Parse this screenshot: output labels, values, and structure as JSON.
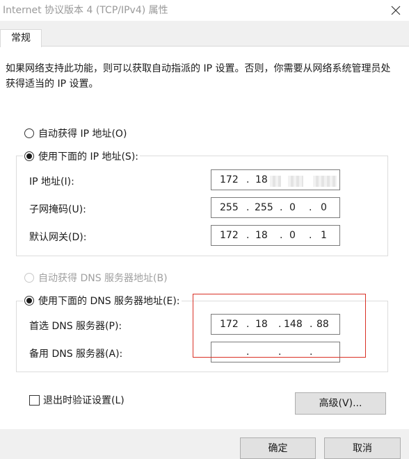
{
  "window": {
    "title": "Internet 协议版本 4 (TCP/IPv4) 属性"
  },
  "tabs": [
    {
      "label": "常规"
    }
  ],
  "description": "如果网络支持此功能，则可以获取自动指派的 IP 设置。否则，你需要从网络系统管理员处获得适当的 IP 设置。",
  "ip_section": {
    "auto_radio_label": "自动获得 IP 地址(O)",
    "manual_radio_label": "使用下面的 IP 地址(S):",
    "selected": "manual",
    "ip_address": {
      "label": "IP 地址(I):",
      "octets": [
        "172",
        "18",
        "",
        ""
      ]
    },
    "subnet_mask": {
      "label": "子网掩码(U):",
      "octets": [
        "255",
        "255",
        "0",
        "0"
      ]
    },
    "default_gateway": {
      "label": "默认网关(D):",
      "octets": [
        "172",
        "18",
        "0",
        "1"
      ]
    }
  },
  "dns_section": {
    "auto_radio_label": "自动获得 DNS 服务器地址(B)",
    "manual_radio_label": "使用下面的 DNS 服务器地址(E):",
    "selected": "manual",
    "preferred_dns": {
      "label": "首选 DNS 服务器(P):",
      "octets": [
        "172",
        "18",
        "148",
        "88"
      ]
    },
    "alternate_dns": {
      "label": "备用 DNS 服务器(A):",
      "octets": [
        "",
        "",
        "",
        ""
      ]
    }
  },
  "validate_on_exit": {
    "label": "退出时验证设置(L)",
    "checked": false
  },
  "buttons": {
    "advanced": "高级(V)...",
    "ok": "确定",
    "cancel": "取消"
  },
  "separator": ".",
  "colors": {
    "highlight": "#d93025",
    "title_text": "#999999",
    "button_bg": "#e1e1e1"
  }
}
